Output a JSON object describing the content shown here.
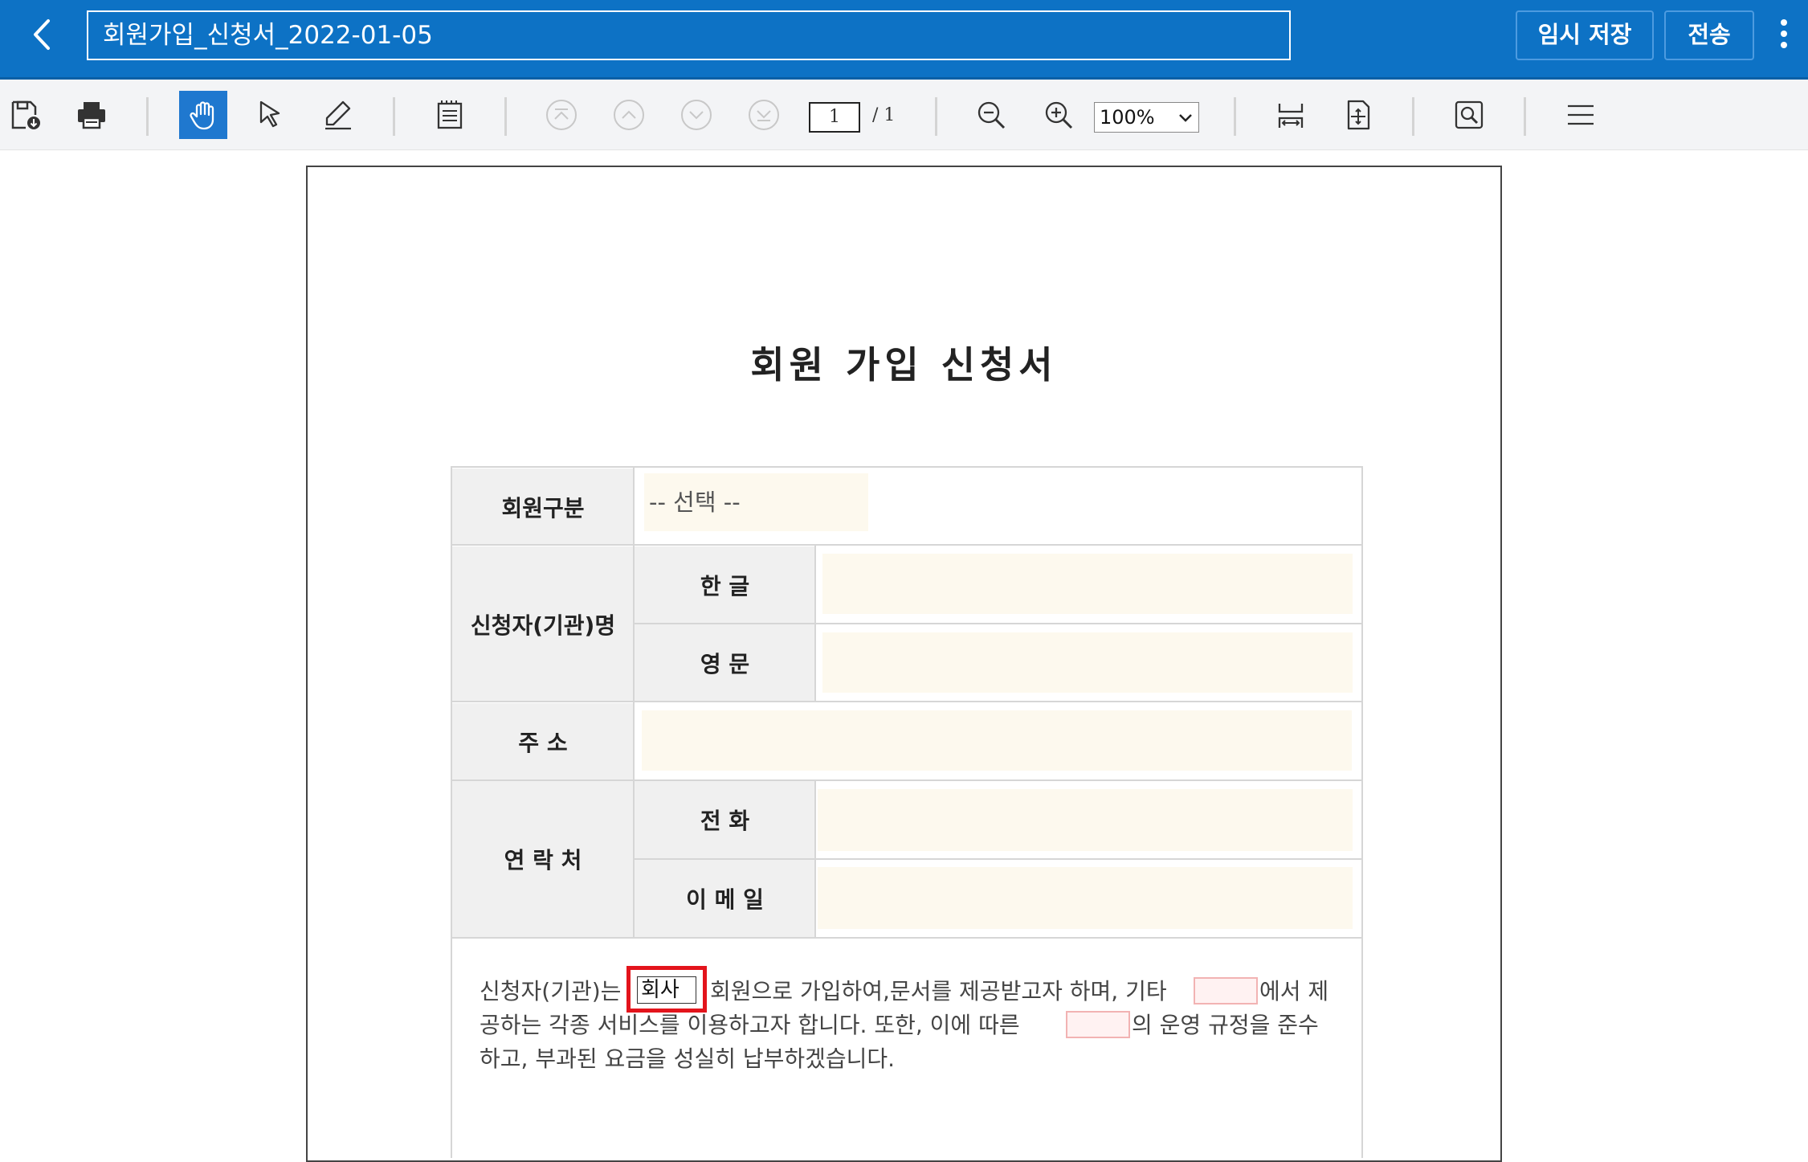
{
  "header": {
    "title": "회원가입_신청서_2022-01-05",
    "temp_save_label": "임시 저장",
    "send_label": "전송"
  },
  "toolbar": {
    "current_page": "1",
    "page_total": "/ 1",
    "zoom": "100%"
  },
  "document": {
    "title": "회원 가입 신청서",
    "rows": {
      "member_type_label": "회원구분",
      "member_type_placeholder": "-- 선택 --",
      "applicant_label": "신청자(기관)명",
      "korean_label": "한 글",
      "english_label": "영 문",
      "address_label": "주 소",
      "contact_label": "연 락 처",
      "phone_label": "전 화",
      "email_label": "이 메 일"
    },
    "paragraph": {
      "line1_a": "신청자(기관)는",
      "company_value": "회사",
      "line1_b": "회원으로 가입하여,문서를 제공받고자 하며, 기타",
      "line1_c": "에서 제",
      "line2_a": "공하는 각종 서비스를 이용하고자 합니다. 또한, 이에 따른",
      "line2_b": "의 운영 규정을 준수",
      "line3": "하고, 부과된 요금을 성실히 납부하겠습니다."
    }
  },
  "colors": {
    "header_bg": "#0d72c5",
    "active_tool": "#1f78cf",
    "field_bg": "#fdf9ee",
    "highlight": "#e3141c"
  }
}
